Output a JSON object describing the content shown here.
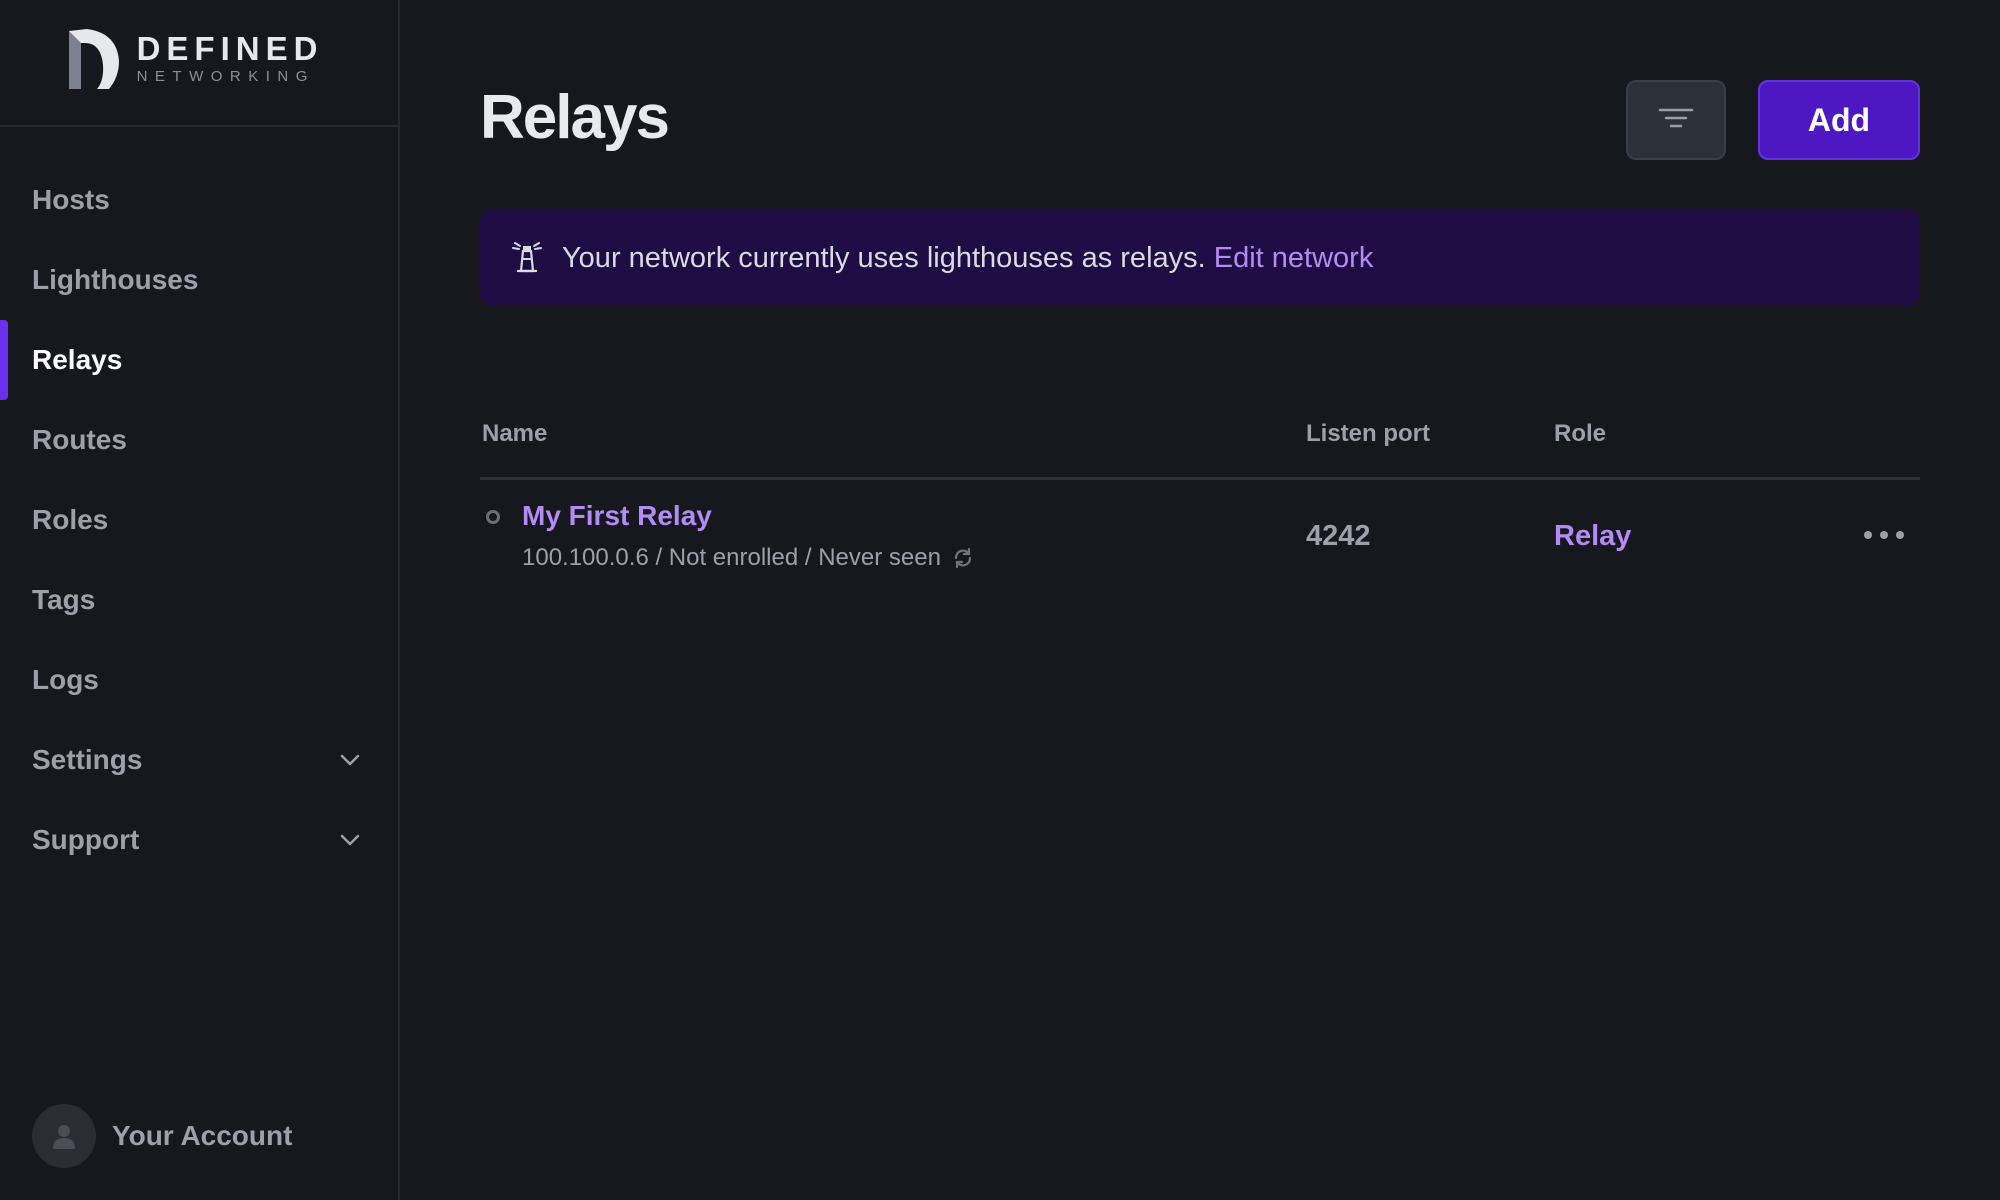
{
  "brand": {
    "top": "DEFINED",
    "bottom": "NETWORKING"
  },
  "sidebar": {
    "items": [
      {
        "label": "Hosts",
        "active": false
      },
      {
        "label": "Lighthouses",
        "active": false
      },
      {
        "label": "Relays",
        "active": true
      },
      {
        "label": "Routes",
        "active": false
      },
      {
        "label": "Roles",
        "active": false
      },
      {
        "label": "Tags",
        "active": false
      },
      {
        "label": "Logs",
        "active": false
      },
      {
        "label": "Settings",
        "active": false,
        "expandable": true
      },
      {
        "label": "Support",
        "active": false,
        "expandable": true
      }
    ],
    "account_label": "Your Account"
  },
  "header": {
    "title": "Relays",
    "add_label": "Add",
    "filter_icon": "filter-icon"
  },
  "banner": {
    "icon": "lighthouse-icon",
    "text": "Your network currently uses lighthouses as relays.",
    "link_text": "Edit network"
  },
  "table": {
    "columns": [
      "Name",
      "Listen port",
      "Role"
    ],
    "rows": [
      {
        "name": "My First Relay",
        "meta": "100.100.0.6 / Not enrolled / Never seen",
        "listen_port": "4242",
        "role": "Relay"
      }
    ]
  },
  "colors": {
    "accent": "#4d18c4",
    "accent_text": "#b38bf5",
    "active_indicator": "#6b2ff0",
    "banner_bg": "#200c45",
    "background": "#16181d"
  }
}
